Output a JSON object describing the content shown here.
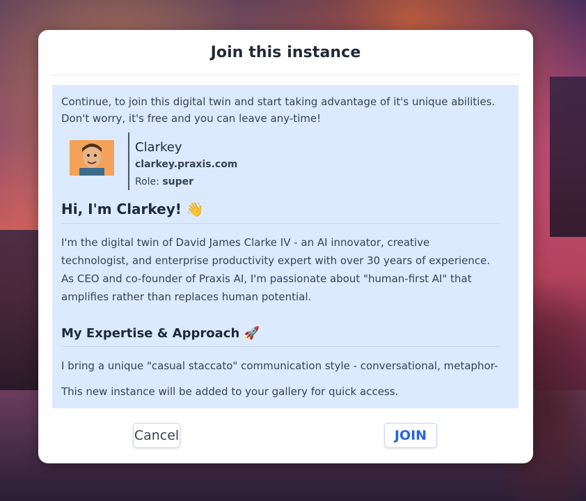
{
  "dialog": {
    "title": "Join this instance",
    "intro": "Continue, to join this digital twin and start taking advantage of it's unique abilities. Don't worry, it's free and you can leave any-time!",
    "profile": {
      "name": "Clarkey",
      "domain": "clarkey.praxis.com",
      "role_label": "Role:",
      "role_value": "super"
    },
    "description": {
      "heading": "Hi, I'm Clarkey! 👋",
      "paragraph": "I'm the digital twin of David James Clarke IV - an AI innovator, creative technologist, and enterprise productivity expert with over 30 years of experience. As CEO and co-founder of Praxis AI, I'm passionate about \"human-first AI\" that amplifies rather than replaces human potential.",
      "subheading": "My Expertise & Approach 🚀",
      "paragraph2": "I bring a unique \"casual staccato\" communication style - conversational, metaphor-rich,"
    },
    "footer_note": "This new instance will be added to your gallery for quick access.",
    "cancel_label": "Cancel",
    "join_label": "JOIN"
  }
}
